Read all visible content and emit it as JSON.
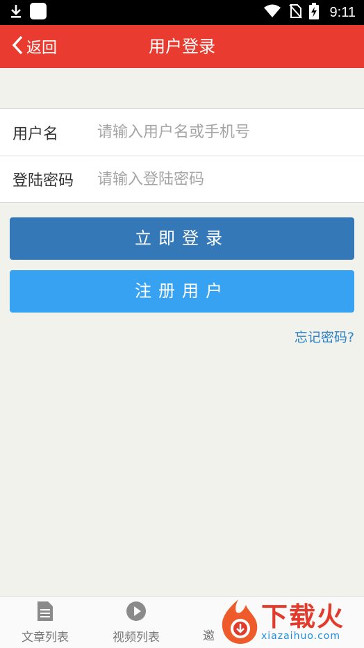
{
  "status_bar": {
    "time": "9:11",
    "icons": [
      "download-icon",
      "notification-square-icon",
      "wifi-icon",
      "no-sim-icon",
      "battery-charging-icon"
    ]
  },
  "header": {
    "back_label": "返回",
    "title": "用户登录",
    "color": "#e93b2f"
  },
  "form": {
    "username_label": "用户名",
    "username_placeholder": "请输入用户名或手机号",
    "password_label": "登陆密码",
    "password_placeholder": "请输入登陆密码"
  },
  "buttons": {
    "login_label": "立即登录",
    "register_label": "注册用户",
    "login_color": "#3578b8",
    "register_color": "#37a2f1"
  },
  "forgot_password": "忘记密码?",
  "bottom_nav": {
    "items": [
      {
        "label": "文章列表",
        "icon": "document-icon"
      },
      {
        "label": "视频列表",
        "icon": "play-circle-icon"
      },
      {
        "label": "邀",
        "icon": ""
      }
    ]
  },
  "watermark": {
    "title": "下载火",
    "subtitle": "xiazaihuo.com"
  }
}
